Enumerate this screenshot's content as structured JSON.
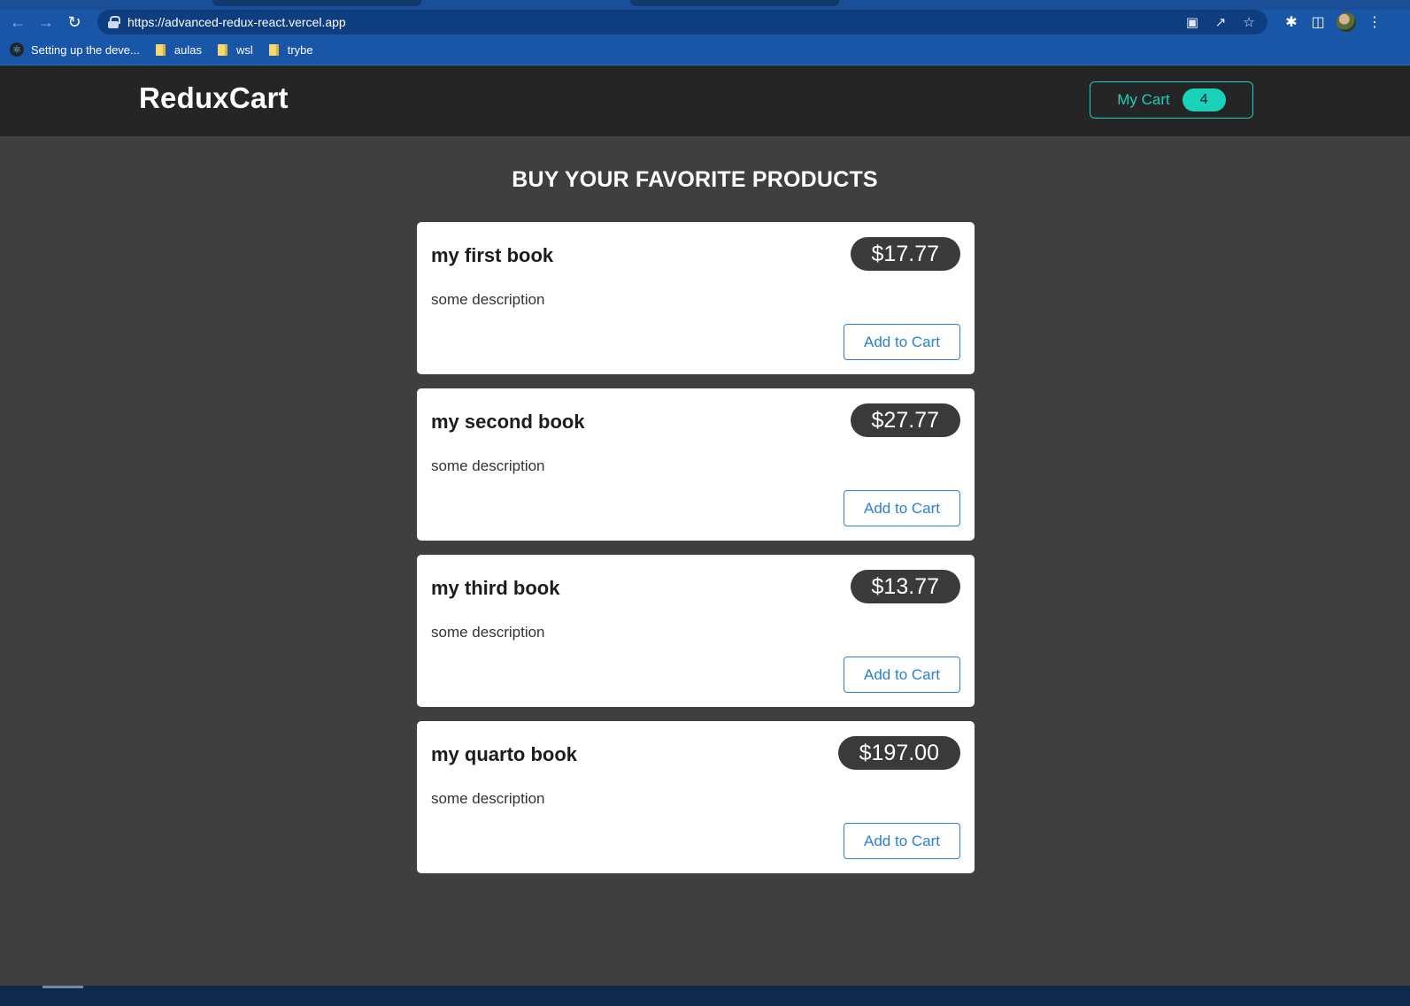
{
  "browser": {
    "url": "https://advanced-redux-react.vercel.app",
    "bookmarks": [
      {
        "label": "Setting up the deve...",
        "icon": "react-icon"
      },
      {
        "label": "aulas",
        "icon": "folder-icon"
      },
      {
        "label": "wsl",
        "icon": "folder-icon"
      },
      {
        "label": "trybe",
        "icon": "folder-icon"
      }
    ]
  },
  "header": {
    "logo": "ReduxCart",
    "cart_label": "My Cart",
    "cart_count": "4"
  },
  "main": {
    "title": "BUY YOUR FAVORITE PRODUCTS",
    "products": [
      {
        "title": "my first book",
        "price": "$17.77",
        "description": "some description",
        "button": "Add to Cart"
      },
      {
        "title": "my second book",
        "price": "$27.77",
        "description": "some description",
        "button": "Add to Cart"
      },
      {
        "title": "my third book",
        "price": "$13.77",
        "description": "some description",
        "button": "Add to Cart"
      },
      {
        "title": "my quarto book",
        "price": "$197.00",
        "description": "some description",
        "button": "Add to Cart"
      }
    ]
  },
  "colors": {
    "accent": "#1ad1b9",
    "link_blue": "#2a80d2",
    "header_bg": "#252525",
    "page_bg": "#3f3f3f",
    "browser_blue": "#1a56a8"
  }
}
